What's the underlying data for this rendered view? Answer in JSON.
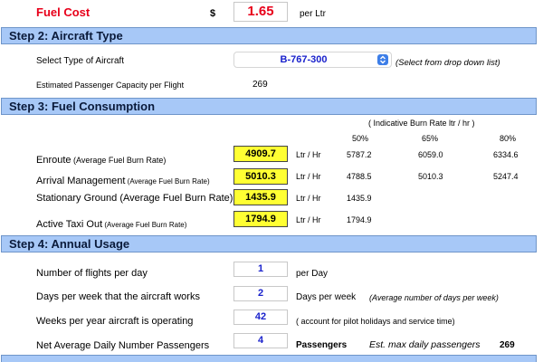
{
  "fuel_cost": {
    "label": "Fuel Cost",
    "currency": "$",
    "value": "1.65",
    "unit": "per Ltr"
  },
  "step2": {
    "header": "Step 2: Aircraft Type",
    "select_label": "Select Type of Aircraft",
    "select_value": "B-767-300",
    "select_hint": "(Select from drop down list)",
    "capacity_label": "Estimated Passenger Capacity per Flight",
    "capacity_value": "269"
  },
  "step3": {
    "header": "Step 3: Fuel Consumption",
    "indicative_title": "( Indicative Burn Rate ltr / hr )",
    "pct_headers": [
      "50%",
      "65%",
      "80%"
    ],
    "rows": [
      {
        "label_main": "Enroute",
        "label_sub": " (Average Fuel Burn Rate)",
        "value": "4909.7",
        "unit": "Ltr / Hr",
        "r50": "5787.2",
        "r65": "6059.0",
        "r80": "6334.6"
      },
      {
        "label_main": "Arrival Management",
        "label_sub": " (Average Fuel Burn Rate)",
        "value": "5010.3",
        "unit": "Ltr / Hr",
        "r50": "4788.5",
        "r65": "5010.3",
        "r80": "5247.4"
      },
      {
        "label_main": "Stationary Ground (Average Fuel Burn Rate)",
        "label_sub": "",
        "value": "1435.9",
        "unit": "Ltr / Hr",
        "r50": "1435.9",
        "r65": "",
        "r80": ""
      },
      {
        "label_main": "Active Taxi Out",
        "label_sub": " (Average Fuel Burn Rate)",
        "value": "1794.9",
        "unit": "Ltr / Hr",
        "r50": "1794.9",
        "r65": "",
        "r80": ""
      }
    ]
  },
  "step4": {
    "header": "Step 4: Annual Usage",
    "flights_label": "Number of flights per day",
    "flights_value": "1",
    "flights_unit": "per Day",
    "days_label": "Days per week that the aircraft works",
    "days_value": "2",
    "days_unit": "Days per week",
    "days_note": "(Average number of days per week)",
    "weeks_label": "Weeks per year aircraft is operating",
    "weeks_value": "42",
    "weeks_note": "( account for pilot holidays and service time)",
    "pax_label": "Net Average Daily Number Passengers",
    "pax_value": "4",
    "pax_unit": "Passengers",
    "est_label": "Est. max daily passengers",
    "est_value": "269"
  },
  "colors": {
    "header_bg": "#a7c8f7",
    "accent_red": "#e8001a",
    "value_blue": "#1a22cc",
    "highlight_yellow": "#ffff33"
  }
}
